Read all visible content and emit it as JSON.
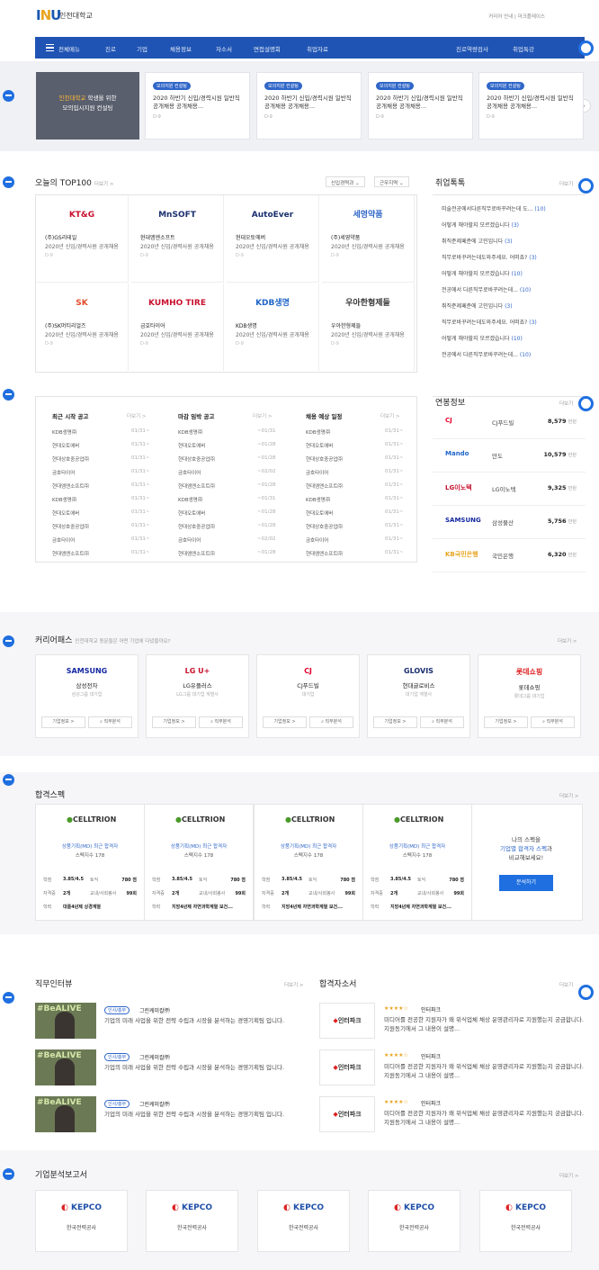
{
  "header": {
    "logo": "INU",
    "logo_text": "인천대학교",
    "links": "커리어 안내 | 마크플레이스"
  },
  "nav": {
    "all": "전체메뉴",
    "items": [
      "진로",
      "기업",
      "채용정보",
      "자소서",
      "면접설명회",
      "취업자료"
    ],
    "right": [
      "진로역량검사",
      "취업특강"
    ]
  },
  "hero": {
    "main_line1": "인천대학교",
    "main_line1b": " 학생을 위한",
    "main_line2": "모의입시지원 컨설팅",
    "cards": [
      {
        "badge": "모의지원 컨설팅",
        "title": "2020 하반기 신입/경력시원 일반직 공개채용 공개채용...",
        "date": "D-9"
      },
      {
        "badge": "모의지원 컨설팅",
        "title": "2020 하반기 신입/경력시원 일반직 공개채용 공개채용...",
        "date": "D-9"
      },
      {
        "badge": "모의지원 컨설팅",
        "title": "2020 하반기 신입/경력시원 일반직 공개채용 공개채용...",
        "date": "D-9"
      },
      {
        "badge": "모의지원 컨설팅",
        "title": "2020 하반기 신입/경력시원 일반직 공개채용 공개채용...",
        "date": "D-9"
      }
    ],
    "next": "›"
  },
  "top100": {
    "title": "오늘의 TOP100",
    "more": "더보기 >",
    "select1": "신입경력과",
    "select2": "근무지역",
    "cards": [
      {
        "logo": "KT&G",
        "name": "(주)GS리테일",
        "title": "2020년 신입/경력사원 공개채용",
        "date": "D-9"
      },
      {
        "logo": "MnSOFT",
        "name": "현대엠엔소프트",
        "title": "2020년 신입/경력사원 공개채용",
        "date": "D-9"
      },
      {
        "logo": "AutoEver",
        "name": "현대오토에버",
        "title": "2020년 신입/경력사원 공개채용",
        "date": "D-9"
      },
      {
        "logo": "세영약품",
        "name": "(주)세영약품",
        "title": "2020년 신입/경력사원 공개채용",
        "date": "D-9"
      },
      {
        "logo": "SK",
        "name": "(주)SK머티리얼즈",
        "title": "2020년 신입/경력사원 공개채용",
        "date": "D-9"
      },
      {
        "logo": "KUMHO TIRE",
        "name": "금호타이어",
        "title": "2020년 신입/경력사원 공개채용",
        "date": "D-9"
      },
      {
        "logo": "KDB생명",
        "name": "KDB생명",
        "title": "2020년 신입/경력사원 공개채용",
        "date": "D-9"
      },
      {
        "logo": "우아한형제들",
        "name": "우아한형제들",
        "title": "2020년 신입/경력사원 공개채용",
        "date": "D-9"
      }
    ]
  },
  "qa": {
    "title": "취업톡톡",
    "more": "더보기",
    "items": [
      {
        "q": "미술전공에서다른직무로바꾸려는데 도...",
        "n": "(10)"
      },
      {
        "q": "어떻게 해야할지 모르겠습니다",
        "n": "(3)"
      },
      {
        "q": "취직준제페준에 고민입니다",
        "n": "(3)"
      },
      {
        "q": "직무로바꾸려는데도와주세요. 어떠죠?",
        "n": "(3)"
      },
      {
        "q": "어떻게 해야할지 모르겠습니다",
        "n": "(10)"
      },
      {
        "q": "전공에서 다른직무로바꾸려는데...",
        "n": "(10)"
      },
      {
        "q": "취직준제페준에 고민입니다",
        "n": "(3)"
      },
      {
        "q": "직무로바꾸려는데도와주세요. 어떠죠?",
        "n": "(3)"
      },
      {
        "q": "어떻게 해야할지 모르겠습니다",
        "n": "(10)"
      },
      {
        "q": "전공에서 다른직무로바꾸려는데...",
        "n": "(10)"
      }
    ]
  },
  "notices": {
    "cols": [
      {
        "title": "최근 시작 공고",
        "more": "더보기 >",
        "rows": [
          [
            "KDB생명㈜",
            "01/31~"
          ],
          [
            "현대오토에버",
            "01/31~"
          ],
          [
            "현대상호중공업㈜",
            "01/31~"
          ],
          [
            "금호타이어",
            "01/31~"
          ],
          [
            "현대엠엔소프트㈜",
            "01/31~"
          ],
          [
            "KDB생명㈜",
            "01/31~"
          ],
          [
            "현대오토에버",
            "01/31~"
          ],
          [
            "현대상호중공업㈜",
            "01/31~"
          ],
          [
            "금호타이어",
            "01/31~"
          ],
          [
            "현대엠엔소프트㈜",
            "01/31~"
          ]
        ]
      },
      {
        "title": "마감 임박 공고",
        "more": "더보기 >",
        "rows": [
          [
            "KDB생명㈜",
            "~01/31"
          ],
          [
            "현대오토에버",
            "~01/28"
          ],
          [
            "현대상호중공업㈜",
            "~01/28"
          ],
          [
            "금호타이어",
            "~02/02"
          ],
          [
            "현대엠엔소프트㈜",
            "~01/28"
          ],
          [
            "KDB생명㈜",
            "~01/31"
          ],
          [
            "현대오토에버",
            "~01/28"
          ],
          [
            "현대상호중공업㈜",
            "~01/28"
          ],
          [
            "금호타이어",
            "~02/02"
          ],
          [
            "현대엠엔소프트㈜",
            "~01/28"
          ]
        ]
      },
      {
        "title": "채용 예상 일정",
        "more": "더보기 >",
        "rows": [
          [
            "KDB생명㈜",
            "01/31~"
          ],
          [
            "현대오토에버",
            "01/31~"
          ],
          [
            "현대상호중공업㈜",
            "01/31~"
          ],
          [
            "금호타이어",
            "01/31~"
          ],
          [
            "현대엠엔소프트㈜",
            "01/31~"
          ],
          [
            "KDB생명㈜",
            "01/31~"
          ],
          [
            "현대오토에버",
            "01/31~"
          ],
          [
            "현대상호중공업㈜",
            "01/31~"
          ],
          [
            "금호타이어",
            "01/31~"
          ],
          [
            "현대엠엔소프트㈜",
            "01/31~"
          ]
        ]
      }
    ]
  },
  "salary": {
    "title": "연봉정보",
    "more": "더보기",
    "unit": "만원",
    "rows": [
      {
        "logo": "CJ",
        "name": "CJ푸드빌",
        "value": "8,579"
      },
      {
        "logo": "Mando",
        "name": "만도",
        "value": "10,579"
      },
      {
        "logo": "LG이노텍",
        "name": "LG이노텍",
        "value": "9,325"
      },
      {
        "logo": "SAMSUNG",
        "name": "삼성물산",
        "value": "5,756"
      },
      {
        "logo": "KB국민은행",
        "name": "국민은행",
        "value": "6,320"
      }
    ]
  },
  "career": {
    "title": "커리어패스",
    "subtitle": "인천대학교 동문들은 어떤 기업에 다녔을까요?",
    "more": "더보기 >",
    "btn1": "기업정보 >",
    "btn2": "직무분석",
    "cards": [
      {
        "logo": "SAMSUNG",
        "name": "삼성전자",
        "sub": "삼성그룹 대기업"
      },
      {
        "logo": "LG U+",
        "name": "LG유플러스",
        "sub": "LG그룹 대기업 계열사"
      },
      {
        "logo": "CJ",
        "name": "CJ푸드빌",
        "sub": "대기업"
      },
      {
        "logo": "GLOVIS",
        "name": "현대글로비스",
        "sub": "대기업 계열사"
      },
      {
        "logo": "롯데쇼핑",
        "name": "롯데쇼핑",
        "sub": "롯데그룹 대기업"
      }
    ]
  },
  "spec": {
    "title": "합격스펙",
    "more": "더보기 >",
    "logo": "CELLTRION",
    "position": "상품기획(MD) 최근 합격자",
    "count": "스펙지수 178",
    "rows": [
      [
        "학점",
        "3.85/4.5",
        "토익",
        "780 점"
      ],
      [
        "자격증",
        "2개",
        "교내/사회봉사",
        "99회"
      ],
      [
        "학력",
        "대졸4년제 상경계열",
        "",
        " "
      ]
    ],
    "rows_alt": [
      [
        "학점",
        "3.85/4.5",
        "토익",
        "780 점"
      ],
      [
        "자격증",
        "2개",
        "교내/사회봉사",
        "99회"
      ],
      [
        "학력",
        "지방4년제 자연과학계열 보건...",
        "",
        ""
      ]
    ],
    "cta_line1": "나의 스펙을",
    "cta_line2a": "기업별 합격자 스펙",
    "cta_line2b": "과",
    "cta_line3": "비교해보세요!",
    "cta_button": "분석하기"
  },
  "interview": {
    "title": "직무인터뷰",
    "more": "더보기 >",
    "tag": "인사/총무",
    "company": "그린케미칼㈜",
    "desc": "기업의 미래 사업을 위한 전략 수립과 시장을 분석하는 경영기획팀 입니다.",
    "thumb": "#BeALIVE"
  },
  "coverletter": {
    "title": "합격자소서",
    "more": "더보기",
    "logo": "인터파크",
    "stars": "★★★★☆",
    "company": "인터파크",
    "desc": "미디어를 전공한 지원자가 왜 위식업체 채상 운영관리자로 지원했는지 궁금합니다. 지원동기에서 그 내용이 설명..."
  },
  "report": {
    "title": "기업분석보고서",
    "more": "더보기 >",
    "logo": "KEPCO",
    "name": "한국전력공사"
  }
}
